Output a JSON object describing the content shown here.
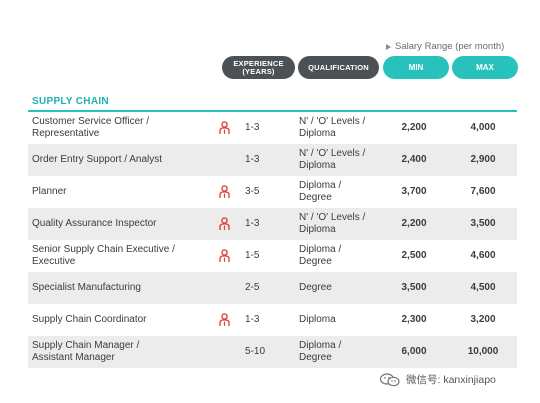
{
  "salary_note": "Salary Range (per month)",
  "headers": {
    "experience": "EXPERIENCE\n(YEARS)",
    "experience_line1": "EXPERIENCE",
    "experience_line2": "(YEARS)",
    "qualification": "QUALIFICATION",
    "min": "MIN",
    "max": "MAX"
  },
  "section": "SUPPLY CHAIN",
  "icon_color": "#e0433f",
  "accent_color": "#28c2bc",
  "rows": [
    {
      "role_l1": "Customer Service Officer /",
      "role_l2": "Representative",
      "icon": "person-icon",
      "exp": "1-3",
      "qual_l1": "N' / 'O' Levels /",
      "qual_l2": "Diploma",
      "min": "2,200",
      "max": "4,000"
    },
    {
      "role_l1": "Order Entry Support / Analyst",
      "role_l2": "",
      "icon": "",
      "exp": "1-3",
      "qual_l1": "N' / 'O' Levels /",
      "qual_l2": "Diploma",
      "min": "2,400",
      "max": "2,900"
    },
    {
      "role_l1": "Planner",
      "role_l2": "",
      "icon": "person-icon",
      "exp": "3-5",
      "qual_l1": "Diploma /",
      "qual_l2": "Degree",
      "min": "3,700",
      "max": "7,600"
    },
    {
      "role_l1": "Quality Assurance Inspector",
      "role_l2": "",
      "icon": "person-icon",
      "exp": "1-3",
      "qual_l1": "N' / 'O' Levels /",
      "qual_l2": "Diploma",
      "min": "2,200",
      "max": "3,500"
    },
    {
      "role_l1": "Senior Supply Chain Executive /",
      "role_l2": "Executive",
      "icon": "person-icon",
      "exp": "1-5",
      "qual_l1": "Diploma /",
      "qual_l2": "Degree",
      "min": "2,500",
      "max": "4,600"
    },
    {
      "role_l1": "Specialist Manufacturing",
      "role_l2": "",
      "icon": "",
      "exp": "2-5",
      "qual_l1": "Degree",
      "qual_l2": "",
      "min": "3,500",
      "max": "4,500"
    },
    {
      "role_l1": "Supply Chain Coordinator",
      "role_l2": "",
      "icon": "person-icon",
      "exp": "1-3",
      "qual_l1": "Diploma",
      "qual_l2": "",
      "min": "2,300",
      "max": "3,200"
    },
    {
      "role_l1": "Supply Chain Manager /",
      "role_l2": "Assistant Manager",
      "icon": "",
      "exp": "5-10",
      "qual_l1": "Diploma /",
      "qual_l2": "Degree",
      "min": "6,000",
      "max": "10,000"
    }
  ],
  "watermark": "微信号: kanxinjiapo"
}
